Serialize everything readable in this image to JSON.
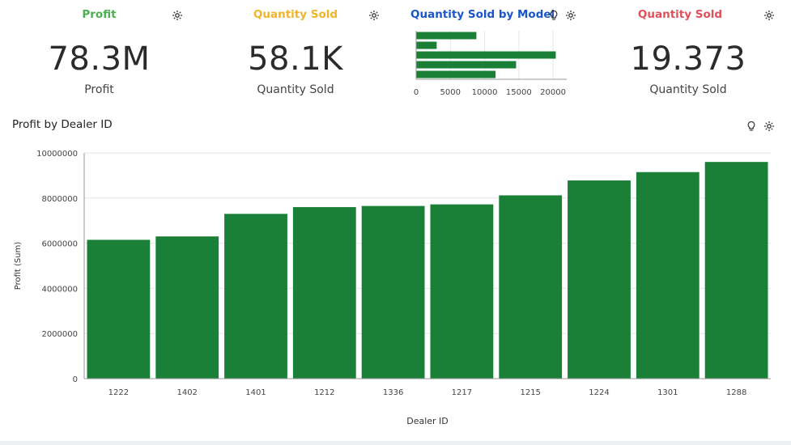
{
  "kpis": [
    {
      "title": "Profit",
      "title_color": "#4caf50",
      "value": "78.3M",
      "label": "Profit"
    },
    {
      "title": "Quantity Sold",
      "title_color": "#f0b429",
      "value": "58.1K",
      "label": "Quantity Sold"
    },
    {
      "title": "Quantity Sold",
      "title_color": "#e0505a",
      "value": "19.373",
      "label": "Quantity Sold"
    }
  ],
  "mini_chart_title": "Quantity Sold by Model",
  "mini_chart_title_color": "#1a56c8",
  "main_chart_title": "Profit by Dealer ID",
  "icons": {
    "settings": "settings-icon",
    "insight": "lightbulb-icon"
  },
  "colors": {
    "bar": "#1a7f37",
    "grid": "#e6e6e6",
    "axis": "#999999"
  },
  "chart_data": [
    {
      "type": "bar",
      "orientation": "horizontal",
      "title": "Quantity Sold by Model",
      "categories": [
        "",
        "",
        "",
        "",
        ""
      ],
      "values": [
        8800,
        3000,
        20400,
        14600,
        11600
      ],
      "xlim": [
        0,
        22000
      ],
      "xticks": [
        "0",
        "5000",
        "10000",
        "15000",
        "20000"
      ],
      "xtick_values": [
        0,
        5000,
        10000,
        15000,
        20000
      ]
    },
    {
      "type": "bar",
      "title": "Profit by Dealer ID",
      "xlabel": "Dealer ID",
      "ylabel": "Profit (Sum)",
      "categories": [
        "1222",
        "1402",
        "1401",
        "1212",
        "1336",
        "1217",
        "1215",
        "1224",
        "1301",
        "1288"
      ],
      "values": [
        6150000,
        6300000,
        7300000,
        7600000,
        7650000,
        7720000,
        8120000,
        8780000,
        9150000,
        9600000
      ],
      "ylim": [
        0,
        10000000
      ],
      "yticks": [
        "0",
        "2000000",
        "4000000",
        "6000000",
        "8000000",
        "10000000"
      ],
      "ytick_values": [
        0,
        2000000,
        4000000,
        6000000,
        8000000,
        10000000
      ],
      "grid": true
    }
  ]
}
